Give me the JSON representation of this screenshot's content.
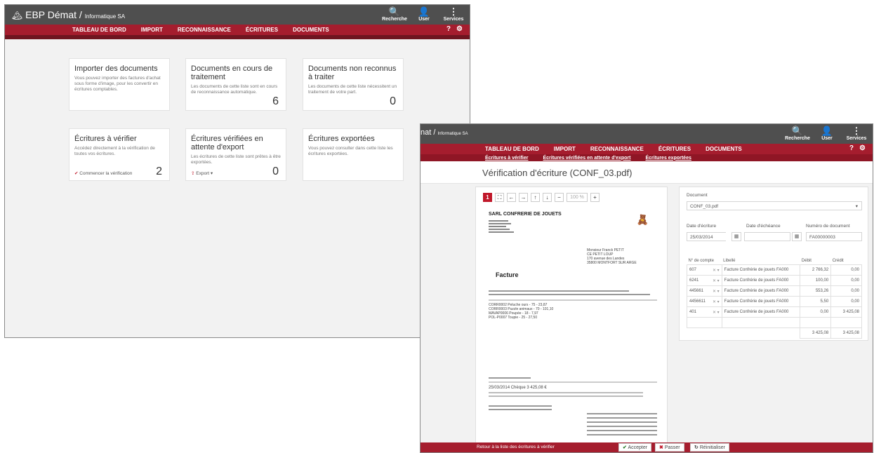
{
  "app": {
    "brand": "EBP Dématr",
    "brand_main": "EBP Démat",
    "company": "Informatique SA",
    "brand_cut": "nat"
  },
  "top_icons": [
    {
      "glyph": "🔍",
      "label": "Recherche"
    },
    {
      "glyph": "👤",
      "label": "User"
    },
    {
      "glyph": "⋮",
      "label": "Services"
    }
  ],
  "menu": [
    "TABLEAU DE BORD",
    "IMPORT",
    "RECONNAISSANCE",
    "ÉCRITURES",
    "DOCUMENTS"
  ],
  "menu_icons": [
    "?",
    "⚙"
  ],
  "dashboard": {
    "cards": [
      {
        "title": "Importer des documents",
        "text": "Vous pouvez importer des factures d'achat sous forme d'image, pour les convertir en écritures comptables.",
        "count": "",
        "action": ""
      },
      {
        "title": "Documents en cours de traitement",
        "text": "Les documents de cette liste sont en cours de reconnaissance automatique.",
        "count": "6",
        "action": ""
      },
      {
        "title": "Documents non reconnus à traiter",
        "text": "Les documents de cette liste nécessitent un traitement de votre part.",
        "count": "0",
        "action": ""
      },
      {
        "title": "Écritures à vérifier",
        "text": "Accédez directement à la vérification de toutes vos écritures.",
        "count": "2",
        "action": "Commencer la vérification"
      },
      {
        "title": "Écritures vérifiées en attente d'export",
        "text": "Les écritures de cette liste sont prêtes à être exportées.",
        "count": "0",
        "action": "Export ▾"
      },
      {
        "title": "Écritures exportées",
        "text": "Vous pouvez consulter dans cette liste les écritures exportées.",
        "count": "",
        "action": ""
      }
    ]
  },
  "verify": {
    "submenu": [
      "Écritures à vérifier",
      "Écritures vérifiées en attente d'export",
      "Écritures exportées"
    ],
    "title": "Vérification d'écriture (CONF_03.pdf)",
    "toolbar": {
      "page": "1",
      "zoom": "100 %"
    },
    "doc": {
      "company": "SARL CONFRERIE DE JOUETS",
      "address": [
        "Monsieur Franck PETIT",
        "CE PETIT LOUP",
        "170 avenue des Landes",
        "35800 MONTFORT SUR ARGE"
      ],
      "heading": "Facture",
      "lines": [
        "CORR0002 Peluche ours - 75 - 23,87",
        "CORR0003 Puzzle animaux - 70 - 101,10",
        "MAVAP0006 Poupée - 18 - 7,97",
        "POL-P0007 Toupie - 25 - 27,50"
      ],
      "payment": "25/03/2014 Chèque 3 425,08 €"
    },
    "form": {
      "document_label": "Document",
      "document_value": "CONF_03.pdf",
      "date_ecriture_label": "Date d'écriture",
      "date_ecriture_value": "25/03/2014",
      "date_echeance_label": "Date d'échéance",
      "date_echeance_value": "",
      "numero_label": "Numéro de document",
      "numero_value": "FA00000003",
      "col_compte": "N° de compte",
      "col_libelle": "Libellé",
      "col_debit": "Débit",
      "col_credit": "Crédit",
      "rows": [
        {
          "compte": "607",
          "libelle": "Facture Confrérie de jouets FA000",
          "debit": "2 766,32",
          "credit": "0,00"
        },
        {
          "compte": "6241",
          "libelle": "Facture Confrérie de jouets FA000",
          "debit": "100,00",
          "credit": "0,00"
        },
        {
          "compte": "445661",
          "libelle": "Facture Confrérie de jouets FA000",
          "debit": "553,26",
          "credit": "0,00"
        },
        {
          "compte": "4456611",
          "libelle": "Facture Confrérie de jouets FA000",
          "debit": "5,50",
          "credit": "0,00"
        },
        {
          "compte": "401",
          "libelle": "Facture Confrérie de jouets FA000",
          "debit": "0,00",
          "credit": "3 425,08"
        }
      ],
      "total_debit": "3 425,08",
      "total_credit": "3 425,08"
    },
    "footer": {
      "back": "Retour à la liste des écritures à vérifier",
      "accept": "Accepter",
      "skip": "Passer",
      "reset": "Réinitialiser"
    }
  }
}
